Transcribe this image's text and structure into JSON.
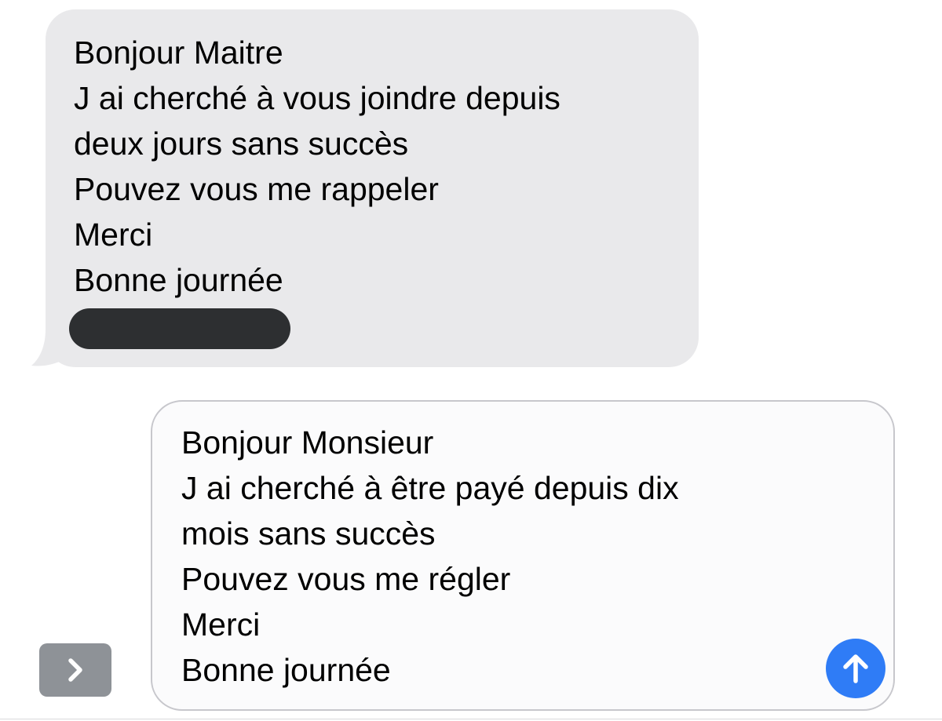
{
  "incoming_message": {
    "lines": [
      "Bonjour Maitre",
      "J ai cherché à vous joindre depuis",
      "deux jours sans succès",
      "Pouvez vous me rappeler",
      "Merci",
      "Bonne journée"
    ],
    "bubble_color": "#e9e9eb",
    "redacted_color": "#2d2f31"
  },
  "compose": {
    "lines": [
      "Bonjour Monsieur",
      "J ai cherché à être payé depuis dix",
      "mois sans succès",
      "Pouvez vous me régler",
      "Merci",
      "Bonne journée"
    ],
    "send_icon": "arrow-up-icon",
    "send_color": "#2f7cf6"
  },
  "expand_button": {
    "icon": "chevron-right-icon",
    "color": "#8e9297"
  }
}
